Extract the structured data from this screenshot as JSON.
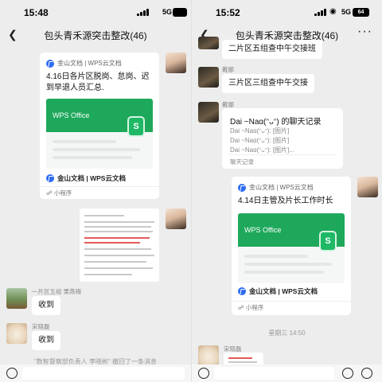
{
  "left": {
    "status": {
      "time": "15:48",
      "network": "5G",
      "battery": ""
    },
    "header": {
      "title": "包头青禾源突击整改(46)"
    },
    "card1": {
      "source": "金山文档 | WPS云文档",
      "title": "4.16日各片区脱岗、怠岗、迟到早退人员汇总.",
      "banner_word": "WPS Office",
      "banner_letter": "S",
      "brand": "金山文档 | WPS云文档",
      "mini": "小程序"
    },
    "messages": [
      {
        "sender": "一片区五组 栗燕梅",
        "text": "收到"
      },
      {
        "sender": "宋晓磊",
        "text": "收到"
      }
    ],
    "system_notice": "\"数智督察部负责人 李晓彬\" 撤回了一条消息"
  },
  "right": {
    "status": {
      "time": "15:52",
      "network": "5G",
      "battery": "64"
    },
    "header": {
      "title": "包头青禾源突击整改(46)"
    },
    "top_messages": [
      {
        "text": "二片区五组查中午交接班"
      },
      {
        "sender": "戴娜",
        "text": "三片区三组查中午交接"
      }
    ],
    "history": {
      "sender": "戴娜",
      "title": "Dai ~Naɑ(ᵔᴗᵔ) 的聊天记录",
      "lines": [
        "Dai ~Naɑ(ᵔᴗᵔ): [图片]",
        "Dai ~Naɑ(ᵔᴗᵔ): [图片]",
        "Dai ~Naɑ(ᵔᴗᵔ): [图片]..."
      ],
      "footer": "聊天记录"
    },
    "card2": {
      "source": "金山文档 | WPS云文档",
      "title": "4.14日主管及片长工作时长",
      "banner_word": "WPS Office",
      "banner_letter": "S",
      "brand": "金山文档 | WPS云文档",
      "mini": "小程序"
    },
    "timestamp": "星期三 14:50",
    "last_sender": "宋晓磊"
  },
  "colors": {
    "accent_green": "#1ea85b",
    "wps_blue": "#2d6bf3",
    "chat_bg": "#ededed"
  }
}
